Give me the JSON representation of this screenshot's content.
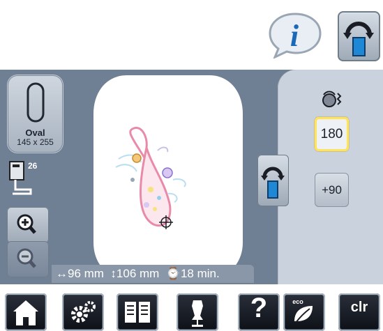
{
  "hoop": {
    "name": "Oval",
    "size": "145 x 255"
  },
  "presser_foot": {
    "number": "26"
  },
  "status": {
    "width": "↔96 mm",
    "height": "↕106 mm",
    "time": "⌚18 min."
  },
  "rotation": {
    "angle_button": "180",
    "plus_button": "+90"
  },
  "bottom_bar": {
    "help": "?",
    "eco": "eco",
    "clear": "clr"
  },
  "icons": {
    "info": "info-icon",
    "rotate_top": "rotate-pattern-icon",
    "rotate_mid": "rotate-pattern-icon",
    "sensor": "thread-sensor-icon",
    "zoom_in": "zoom-in-icon",
    "zoom_out": "zoom-out-icon",
    "home": "home-icon",
    "settings": "settings-icon",
    "tutorial": "book-icon",
    "creative": "dress-form-icon",
    "help": "help-icon",
    "eco": "eco-icon"
  },
  "colors": {
    "screen_bg": "#6f7f94",
    "panel_bg": "#c9d2dd",
    "highlight": "#ffe45a",
    "accent_blue": "#1f88d6"
  }
}
